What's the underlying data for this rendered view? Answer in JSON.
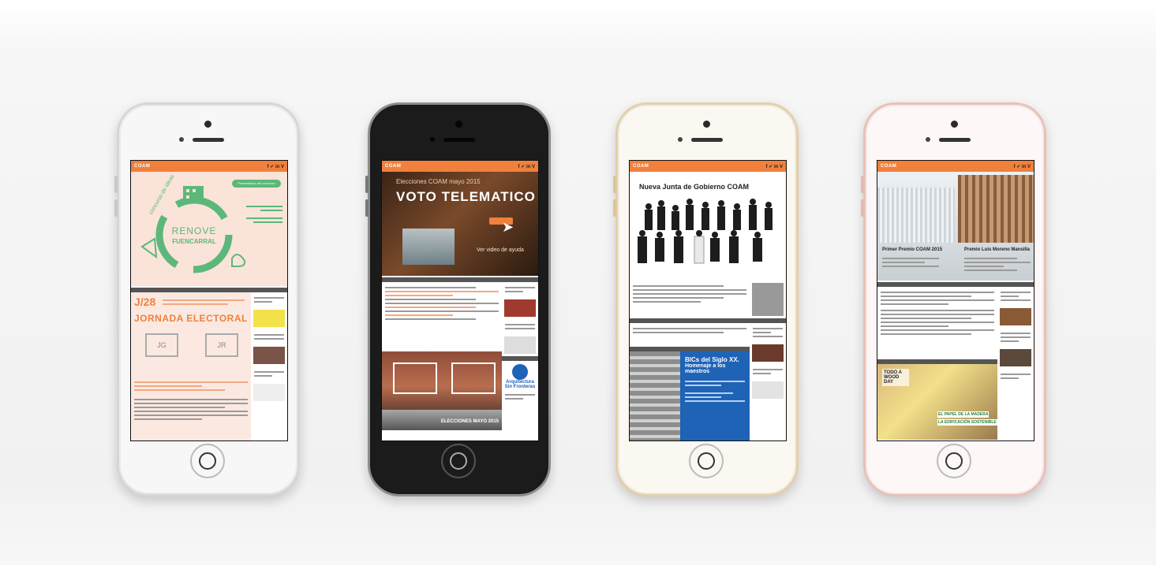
{
  "phones": [
    {
      "finish": "silver",
      "hero": {
        "headline": "RENOVE",
        "subheadline": "FUENCARRAL",
        "arc_text": "concurso de ideas",
        "badge": "Presentación del concurso"
      },
      "section": {
        "headline": "J/28",
        "title": "JORNADA ELECTORAL",
        "box_a": "JG",
        "box_b": "JR"
      }
    },
    {
      "finish": "black",
      "hero": {
        "kicker": "Elecciones COAM mayo 2015",
        "headline": "VOTO TELEMATICO",
        "link": "Ver video de ayuda"
      },
      "promo": {
        "line1": "Arquitectura",
        "line2": "Sin Fronteras"
      },
      "footer": "ELECCIONES MAYO 2015"
    },
    {
      "finish": "gold",
      "hero": {
        "headline": "Nueva Junta de Gobierno COAM"
      },
      "feature": {
        "title": "BICs del Siglo XX.",
        "subtitle": "Homenaje a los maestros"
      }
    },
    {
      "finish": "rose",
      "hero": {
        "caption_left": "Primer Premio COAM 2015",
        "caption_right": "Premio Luis Moreno Mansilla"
      },
      "promo": {
        "box": "TODO A WOOD DAY",
        "title": "EL PAPEL DE LA MADERA",
        "subtitle": "LA EDIFICACIÓN SOSTENIBLE"
      }
    }
  ],
  "header": {
    "logo": "COAM",
    "social": "f ✔ in V"
  },
  "colors": {
    "accent": "#f0803c",
    "green": "#5cb87a",
    "salmon": "#f6d9cb",
    "blue": "#1f63b7"
  }
}
